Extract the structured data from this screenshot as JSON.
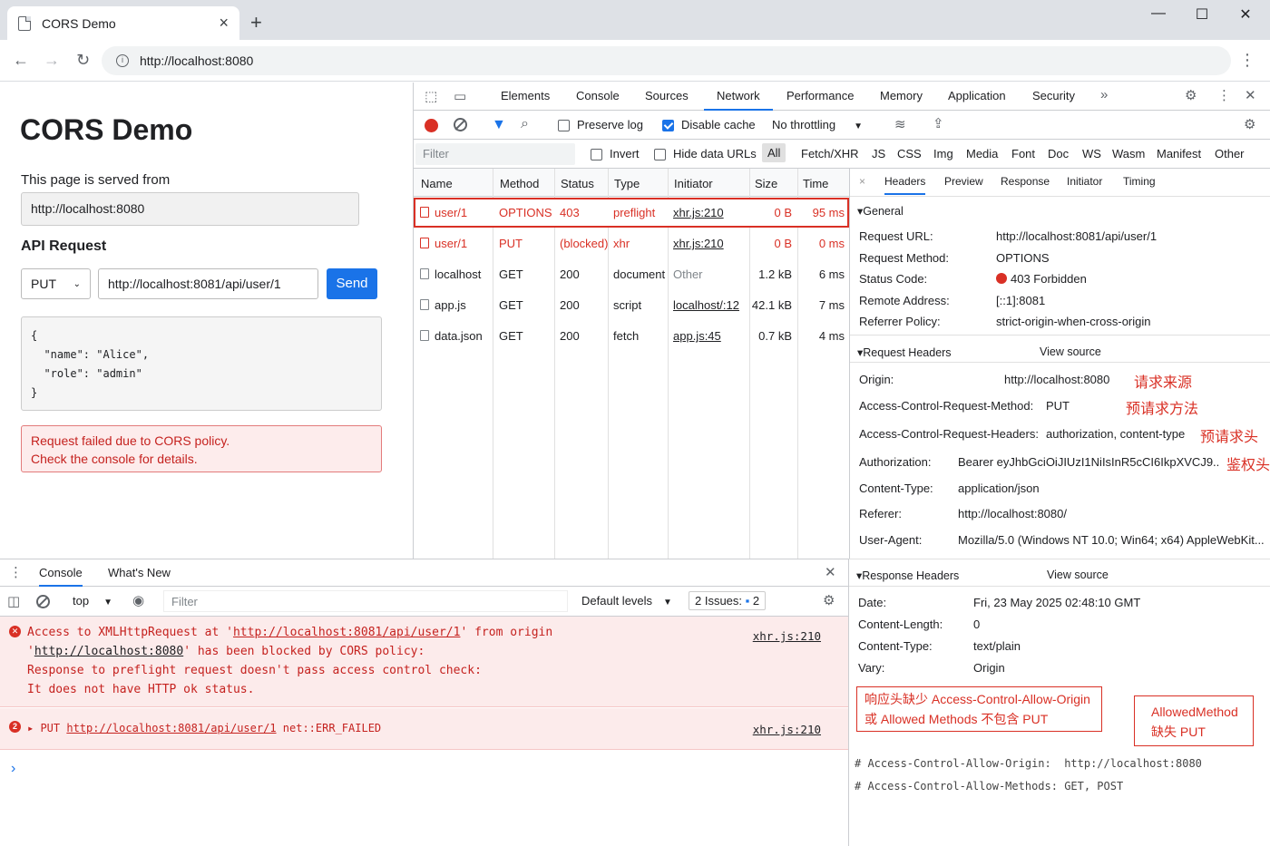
{
  "browser": {
    "tab_title": "CORS Demo",
    "url": "http://localhost:8080",
    "new_tab": "+",
    "close_tab": "×",
    "win_min": "—",
    "win_max": "☐",
    "win_close": "✕"
  },
  "page": {
    "title": "CORS Demo",
    "served_label": "This page is served from",
    "served_url": "http://localhost:8080",
    "api_heading": "API Request",
    "method": "PUT",
    "api_url": "http://localhost:8081/api/user/1",
    "send_label": "Send",
    "body": "{\n  \"name\": \"Alice\",\n  \"role\": \"admin\"\n}",
    "error_line1": "Request failed due to CORS policy.",
    "error_line2": "Check the console for details."
  },
  "devtools": {
    "tabs": [
      "Elements",
      "Console",
      "Sources",
      "Network",
      "Performance",
      "Memory",
      "Application",
      "Security"
    ],
    "more": "»",
    "toolbar": {
      "preserve_log": "Preserve log",
      "disable_cache": "Disable cache",
      "throttling": "No throttling"
    },
    "filter": {
      "placeholder": "Filter",
      "invert": "Invert",
      "hide_data_urls": "Hide data URLs",
      "types": [
        "All",
        "Fetch/XHR",
        "JS",
        "CSS",
        "Img",
        "Media",
        "Font",
        "Doc",
        "WS",
        "Wasm",
        "Manifest",
        "Other"
      ]
    },
    "columns": [
      "Name",
      "Method",
      "Status",
      "Type",
      "Initiator",
      "Size",
      "Time"
    ],
    "requests": [
      {
        "name": "user/1",
        "method": "OPTIONS",
        "status": "403",
        "type": "preflight",
        "initiator": "xhr.js:210",
        "size": "0 B",
        "time": "95 ms"
      },
      {
        "name": "user/1",
        "method": "PUT",
        "status": "(blocked)",
        "type": "xhr",
        "initiator": "xhr.js:210",
        "size": "0 B",
        "time": "0 ms"
      },
      {
        "name": "localhost",
        "method": "GET",
        "status": "200",
        "type": "document",
        "initiator": "Other",
        "size": "1.2 kB",
        "time": "6 ms"
      },
      {
        "name": "app.js",
        "method": "GET",
        "status": "200",
        "type": "script",
        "initiator": "localhost/:12",
        "size": "42.1 kB",
        "time": "7 ms"
      },
      {
        "name": "data.json",
        "method": "GET",
        "status": "200",
        "type": "fetch",
        "initiator": "app.js:45",
        "size": "0.7 kB",
        "time": "4 ms"
      }
    ],
    "details": {
      "close": "×",
      "tabs": [
        "Headers",
        "Preview",
        "Response",
        "Initiator",
        "Timing"
      ],
      "general_head": "▾General",
      "general": [
        {
          "k": "Request URL:",
          "v": "http://localhost:8081/api/user/1"
        },
        {
          "k": "Request Method:",
          "v": "OPTIONS"
        },
        {
          "k": "Status Code:",
          "v": "403 Forbidden"
        },
        {
          "k": "Remote Address:",
          "v": "[::1]:8081"
        },
        {
          "k": "Referrer Policy:",
          "v": "strict-origin-when-cross-origin"
        }
      ],
      "req_head": "▾Request Headers",
      "view_source": "View source",
      "req_headers": [
        {
          "k": "Origin:",
          "v": "http://localhost:8080",
          "note": "请求来源"
        },
        {
          "k": "Access-Control-Request-Method:",
          "v": "PUT",
          "note": "预请求方法"
        },
        {
          "k": "Access-Control-Request-Headers:",
          "v": "authorization, content-type",
          "note": "预请求头"
        },
        {
          "k": "Authorization:",
          "v": "Bearer eyJhbGciOiJIUzI1NiIsInR5cCI6IkpXVCJ9..",
          "note": "鉴权头"
        },
        {
          "k": "Content-Type:",
          "v": "application/json",
          "note": ""
        },
        {
          "k": "Referer:",
          "v": "http://localhost:8080/",
          "note": ""
        },
        {
          "k": "User-Agent:",
          "v": "Mozilla/5.0 (Windows NT 10.0; Win64; x64) AppleWebKit...",
          "note": ""
        }
      ],
      "resp_head": "▾Response Headers",
      "resp_headers": [
        {
          "k": "Date:",
          "v": "Fri, 23 May 2025 02:48:10 GMT"
        },
        {
          "k": "Content-Length:",
          "v": "0"
        },
        {
          "k": "Content-Type:",
          "v": "text/plain"
        },
        {
          "k": "Vary:",
          "v": "Origin"
        }
      ],
      "box1_line1": "响应头缺少 Access-Control-Allow-Origin",
      "box1_line2": "或 Allowed Methods 不包含 PUT",
      "box2_line1": "AllowedMethod",
      "box2_line2": "缺失 PUT",
      "code1": "# Access-Control-Allow-Origin:  http://localhost:8080",
      "code2": "# Access-Control-Allow-Methods: GET, POST"
    }
  },
  "console": {
    "tabs": [
      "Console",
      "What's New"
    ],
    "context": "top",
    "filter_placeholder": "Filter",
    "levels": "Default levels",
    "issues": "2 Issues:",
    "issues_count": "2",
    "msg1": {
      "line1a": "Access to XMLHttpRequest at '",
      "line1_url": "http://localhost:8081/api/user/1",
      "line1b": "' from origin",
      "line2a": "'",
      "line2_url": "http://localhost:8080",
      "line2b": "' has been blocked by CORS policy:",
      "line3": "Response to preflight request doesn't pass access control check:",
      "line4": "It does not have HTTP ok status.",
      "src": "xhr.js:210"
    },
    "msg2": {
      "prefix": "▸ PUT ",
      "url": "http://localhost:8081/api/user/1",
      "suffix": " net::ERR_FAILED",
      "src": "xhr.js:210",
      "count": "2"
    },
    "prompt": "›"
  }
}
